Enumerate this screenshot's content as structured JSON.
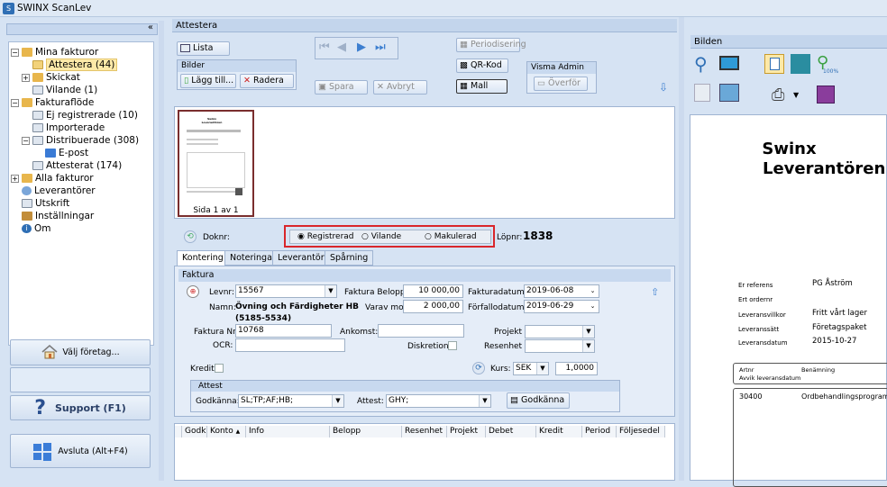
{
  "app": {
    "title": "SWINX ScanLev",
    "icon": "swinx-app-icon"
  },
  "left": {
    "collapse_label": "«",
    "tree": [
      {
        "label": "Mina fakturor",
        "icon": "folder-icon",
        "expander": "−"
      },
      {
        "label": "Attestera (44)",
        "icon": "open-folder-icon"
      },
      {
        "label": "Skickat",
        "icon": "folder-icon",
        "expander": "+"
      },
      {
        "label": "Vilande (1)",
        "icon": "document-icon"
      },
      {
        "label": "Fakturaflöde",
        "icon": "folder-icon",
        "expander": "−"
      },
      {
        "label": "Ej registrerade (10)",
        "icon": "document-icon"
      },
      {
        "label": "Importerade",
        "icon": "document-icon"
      },
      {
        "label": "Distribuerade (308)",
        "icon": "document-icon",
        "expander": "−"
      },
      {
        "label": "E-post",
        "icon": "mail-icon"
      },
      {
        "label": "Attesterat (174)",
        "icon": "document-icon"
      },
      {
        "label": "Alla fakturor",
        "icon": "folder-icon",
        "expander": "+"
      },
      {
        "label": "Leverantörer",
        "icon": "globe-icon"
      },
      {
        "label": "Utskrift",
        "icon": "print-list-icon"
      },
      {
        "label": "Inställningar",
        "icon": "settings-icon"
      },
      {
        "label": "Om",
        "icon": "info-icon"
      }
    ],
    "choose_company": "Välj företag...",
    "support": "Support (F1)",
    "exit": "Avsluta (Alt+F4)"
  },
  "attest": {
    "header": "Attestera",
    "list_btn": "Lista",
    "bilder_group": "Bilder",
    "add_btn": "Lägg till...",
    "delete_btn": "Radera",
    "save_btn": "Spara",
    "cancel_btn": "Avbryt",
    "periodisering_btn": "Periodisering",
    "qr_btn": "QR-Kod",
    "mall_btn": "Mall",
    "visma_group": "Visma Admin",
    "transfer_btn": "Överför",
    "thumb_caption": "Sida 1 av 1",
    "thumb_title": "Swinx Leverantören",
    "doknr_label": "Doknr:",
    "status_options": [
      "Registrerad",
      "Vilande",
      "Makulerad"
    ],
    "status_selected": "Registrerad",
    "lopnr_label": "Löpnr:",
    "lopnr_value": "1838",
    "tabs": [
      "Kontering",
      "Noteringar",
      "Leverantör",
      "Spårning"
    ],
    "faktura_group": "Faktura",
    "levnr_label": "Levnr:",
    "levnr_value": "15567",
    "namn_label": "Namn:",
    "namn_value": "Övning och Färdigheter HB",
    "namn_sub": "(5185-5534)",
    "belopp_label": "Faktura Belopp:",
    "belopp_value": "10 000,00",
    "moms_label": "Varav moms:",
    "moms_value": "2 000,00",
    "fakturadatum_label": "Fakturadatum:",
    "fakturadatum_value": "2019-06-08",
    "forfallodatum_label": "Förfallodatum:",
    "forfallodatum_value": "2019-06-29",
    "fakturanr_label": "Faktura Nr:",
    "fakturanr_value": "10768",
    "ocr_label": "OCR:",
    "ocr_value": "",
    "ankomst_label": "Ankomst:",
    "ankomst_value": "",
    "diskretion_label": "Diskretion:",
    "projekt_label": "Projekt",
    "resenhet_label": "Resenhet",
    "kredit_label": "Kredit",
    "kurs_label": "Kurs:",
    "kurs_currency": "SEK",
    "kurs_value": "1,0000",
    "attest_group": "Attest",
    "godkanna_label": "Godkänna:",
    "godkanna_value": "SL;TP;AF;HB;",
    "attest_label": "Attest:",
    "attest_value": "GHY;",
    "godkanna_btn": "Godkänna",
    "grid_cols": [
      "Godk",
      "Konto",
      "Info",
      "Belopp",
      "Resenhet",
      "Projekt",
      "Debet",
      "Kredit",
      "Period",
      "Följesedel"
    ],
    "sort_indicator": "▲"
  },
  "bilden": {
    "header": "Bilden",
    "zoom_label": "100%",
    "doc_title1": "Swinx",
    "doc_title2": "Leverantören",
    "doc_rows": [
      {
        "k": "Er referens",
        "v": "PG Åström"
      },
      {
        "k": "Ert ordernr",
        "v": ""
      },
      {
        "k": "Leveransvillkor",
        "v": "Fritt vårt lager"
      },
      {
        "k": "Leveranssätt",
        "v": "Företagspaket"
      },
      {
        "k": "Leveransdatum",
        "v": "2015-10-27"
      }
    ],
    "doc_col1": "Artnr",
    "doc_col2": "Benämning",
    "doc_col3": "Avvik leveransdatum",
    "doc_art": "30400",
    "doc_ben": "Ordbehandlingsprogram"
  },
  "colors": {
    "accent": "#2f6fb5",
    "highlight_box": "#d9262b",
    "selected": "#fde9a8"
  }
}
